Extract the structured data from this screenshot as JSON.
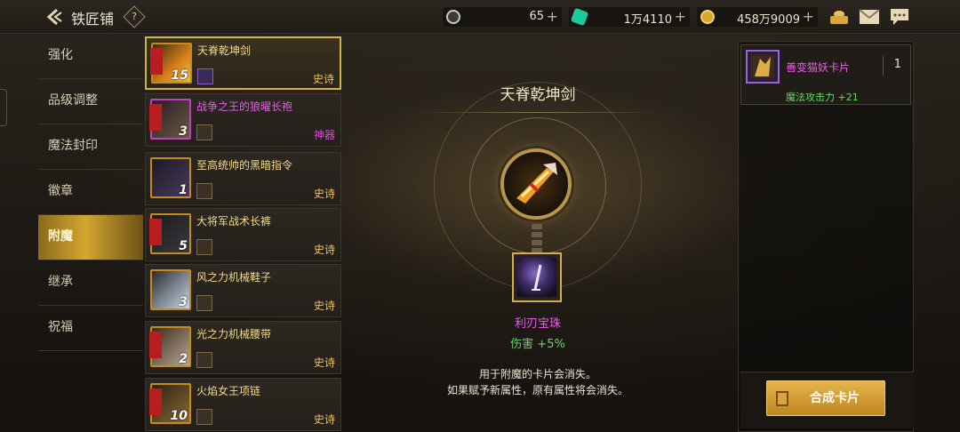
{
  "header": {
    "title": "铁匠铺",
    "help_label": "?",
    "currency1": "65",
    "currency2": "1万4110",
    "currency3": "458万9009",
    "plus": "+"
  },
  "menu": {
    "items": [
      "强化",
      "品级调整",
      "魔法封印",
      "徽章",
      "附魔",
      "继承",
      "祝福"
    ],
    "active_index": 4
  },
  "items": [
    {
      "name": "天脊乾坤剑",
      "rarity": "史诗",
      "level": "15"
    },
    {
      "name": "战争之王的狼曜长袍",
      "rarity": "神器",
      "level": "3"
    },
    {
      "name": "至高统帅的黑暗指令",
      "rarity": "史诗",
      "level": "1"
    },
    {
      "name": "大将军战术长裤",
      "rarity": "史诗",
      "level": "5"
    },
    {
      "name": "风之力机械鞋子",
      "rarity": "史诗",
      "level": "3"
    },
    {
      "name": "光之力机械腰带",
      "rarity": "史诗",
      "level": "2"
    },
    {
      "name": "火焰女王项链",
      "rarity": "史诗",
      "level": "10"
    }
  ],
  "center": {
    "item_title": "天脊乾坤剑",
    "card_name": "利刃宝珠",
    "card_stat": "伤害 +5%",
    "notice_line1": "用于附魔的卡片会消失。",
    "notice_line2": "如果赋予新属性，原有属性将会消失。"
  },
  "right": {
    "card_name": "善变猫妖卡片",
    "card_count": "1",
    "card_stat": "魔法攻击力 +21",
    "synth_label": "合成卡片"
  },
  "colors": {
    "gold": "#d8b04a",
    "epic": "#f0c060",
    "artifact": "#e048e0",
    "stat_green": "#6bd46b"
  }
}
